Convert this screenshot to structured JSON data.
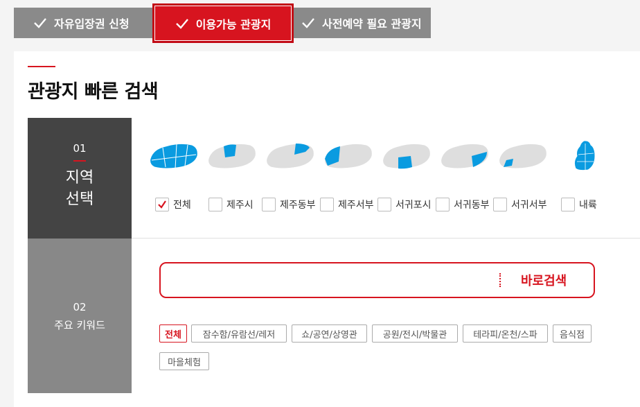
{
  "tabs": [
    {
      "label": "자유입장권 신청",
      "active": false
    },
    {
      "label": "이용가능 관광지",
      "active": true
    },
    {
      "label": "사전예약 필요 관광지",
      "active": false
    }
  ],
  "section_title": "관광지 빠른 검색",
  "step1": {
    "number": "01",
    "label": "지역 선택"
  },
  "step2": {
    "number": "02",
    "label": "주요 키워드"
  },
  "regions": [
    {
      "label": "전체",
      "checked": true
    },
    {
      "label": "제주시",
      "checked": false
    },
    {
      "label": "제주동부",
      "checked": false
    },
    {
      "label": "제주서부",
      "checked": false
    },
    {
      "label": "서귀포시",
      "checked": false
    },
    {
      "label": "서귀동부",
      "checked": false
    },
    {
      "label": "서귀서부",
      "checked": false
    },
    {
      "label": "내륙",
      "checked": false
    }
  ],
  "search": {
    "value": "",
    "placeholder": "",
    "button_label": "바로검색"
  },
  "keywords": [
    {
      "label": "전체",
      "active": true
    },
    {
      "label": "잠수함/유람선/레저",
      "active": false
    },
    {
      "label": "쇼/공연/상영관",
      "active": false
    },
    {
      "label": "공원/전시/박물관",
      "active": false
    },
    {
      "label": "테라피/온천/스파",
      "active": false
    },
    {
      "label": "음식점",
      "active": false
    },
    {
      "label": "마을체험",
      "active": false
    }
  ],
  "colors": {
    "accent": "#d7141f",
    "map_highlight": "#0a9be0",
    "map_base": "#dedede"
  }
}
